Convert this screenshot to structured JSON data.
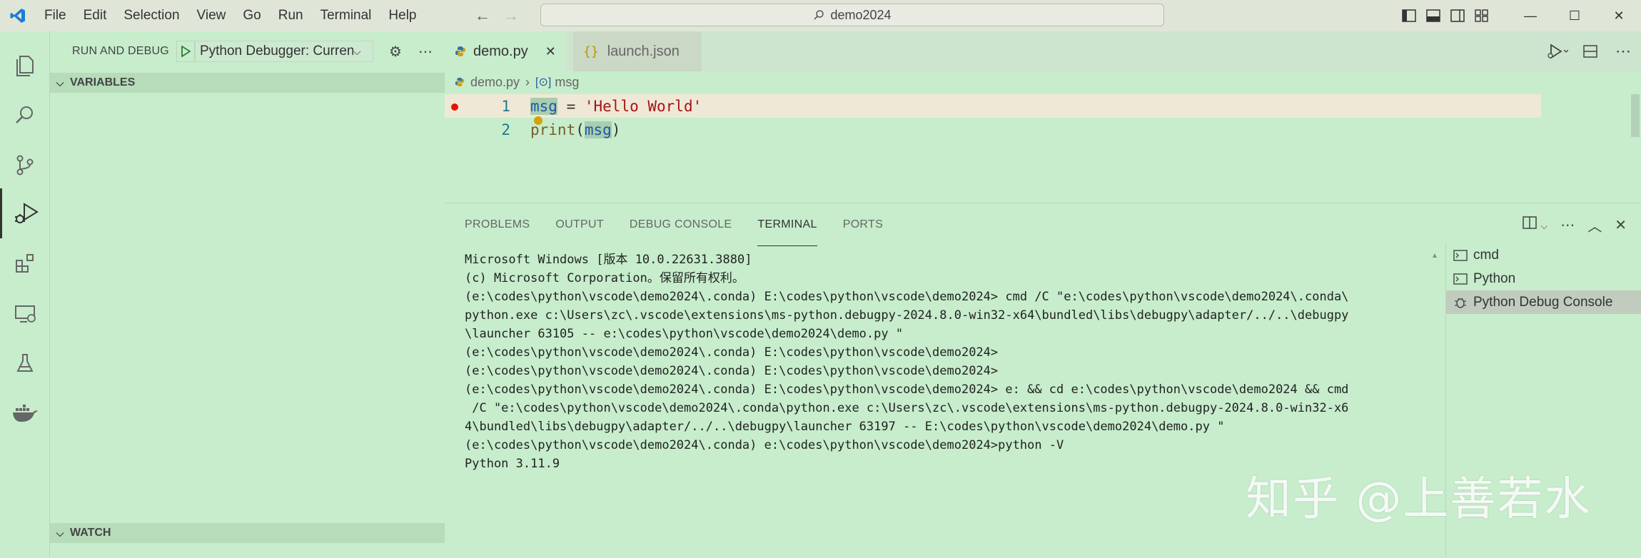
{
  "menu": [
    "File",
    "Edit",
    "Selection",
    "View",
    "Go",
    "Run",
    "Terminal",
    "Help"
  ],
  "search": {
    "text": "demo2024"
  },
  "sidebar": {
    "title": "RUN AND DEBUG",
    "config": "Python Debugger: Current File",
    "sections": {
      "variables": "VARIABLES",
      "watch": "WATCH"
    }
  },
  "tabs": [
    {
      "label": "demo.py",
      "active": true
    },
    {
      "label": "launch.json",
      "active": false
    }
  ],
  "breadcrumb": {
    "file": "demo.py",
    "symbol": "msg"
  },
  "code": {
    "line1": {
      "num": "1",
      "var": "msg",
      "op": " = ",
      "str": "'Hello World'"
    },
    "line2": {
      "num": "2",
      "fn": "print",
      "open": "(",
      "arg": "msg",
      "close": ")"
    }
  },
  "panel": {
    "tabs": [
      "PROBLEMS",
      "OUTPUT",
      "DEBUG CONSOLE",
      "TERMINAL",
      "PORTS"
    ],
    "active_tab": "TERMINAL"
  },
  "terminal_lines": [
    "Microsoft Windows [版本 10.0.22631.3880]",
    "(c) Microsoft Corporation。保留所有权利。",
    "",
    "(e:\\codes\\python\\vscode\\demo2024\\.conda) E:\\codes\\python\\vscode\\demo2024> cmd /C \"e:\\codes\\python\\vscode\\demo2024\\.conda\\",
    "python.exe c:\\Users\\zc\\.vscode\\extensions\\ms-python.debugpy-2024.8.0-win32-x64\\bundled\\libs\\debugpy\\adapter/../..\\debugpy",
    "\\launcher 63105 -- e:\\codes\\python\\vscode\\demo2024\\demo.py \"",
    "",
    "(e:\\codes\\python\\vscode\\demo2024\\.conda) E:\\codes\\python\\vscode\\demo2024>",
    "",
    "(e:\\codes\\python\\vscode\\demo2024\\.conda) E:\\codes\\python\\vscode\\demo2024>",
    "(e:\\codes\\python\\vscode\\demo2024\\.conda) E:\\codes\\python\\vscode\\demo2024> e: && cd e:\\codes\\python\\vscode\\demo2024 && cmd",
    " /C \"e:\\codes\\python\\vscode\\demo2024\\.conda\\python.exe c:\\Users\\zc\\.vscode\\extensions\\ms-python.debugpy-2024.8.0-win32-x6",
    "4\\bundled\\libs\\debugpy\\adapter/../..\\debugpy\\launcher 63197 -- E:\\codes\\python\\vscode\\demo2024\\demo.py \"",
    "",
    "(e:\\codes\\python\\vscode\\demo2024\\.conda) e:\\codes\\python\\vscode\\demo2024>python -V",
    "Python 3.11.9"
  ],
  "terminals": [
    {
      "label": "cmd",
      "icon": "terminal-icon",
      "active": false
    },
    {
      "label": "Python",
      "icon": "terminal-icon",
      "active": false
    },
    {
      "label": "Python Debug Console",
      "icon": "debug-icon",
      "active": true
    }
  ],
  "watermark": "知乎 @上善若水",
  "colors": {
    "background": "#c7edcc",
    "breakpoint": "#e51400",
    "current_line": "#f0e8d6"
  }
}
